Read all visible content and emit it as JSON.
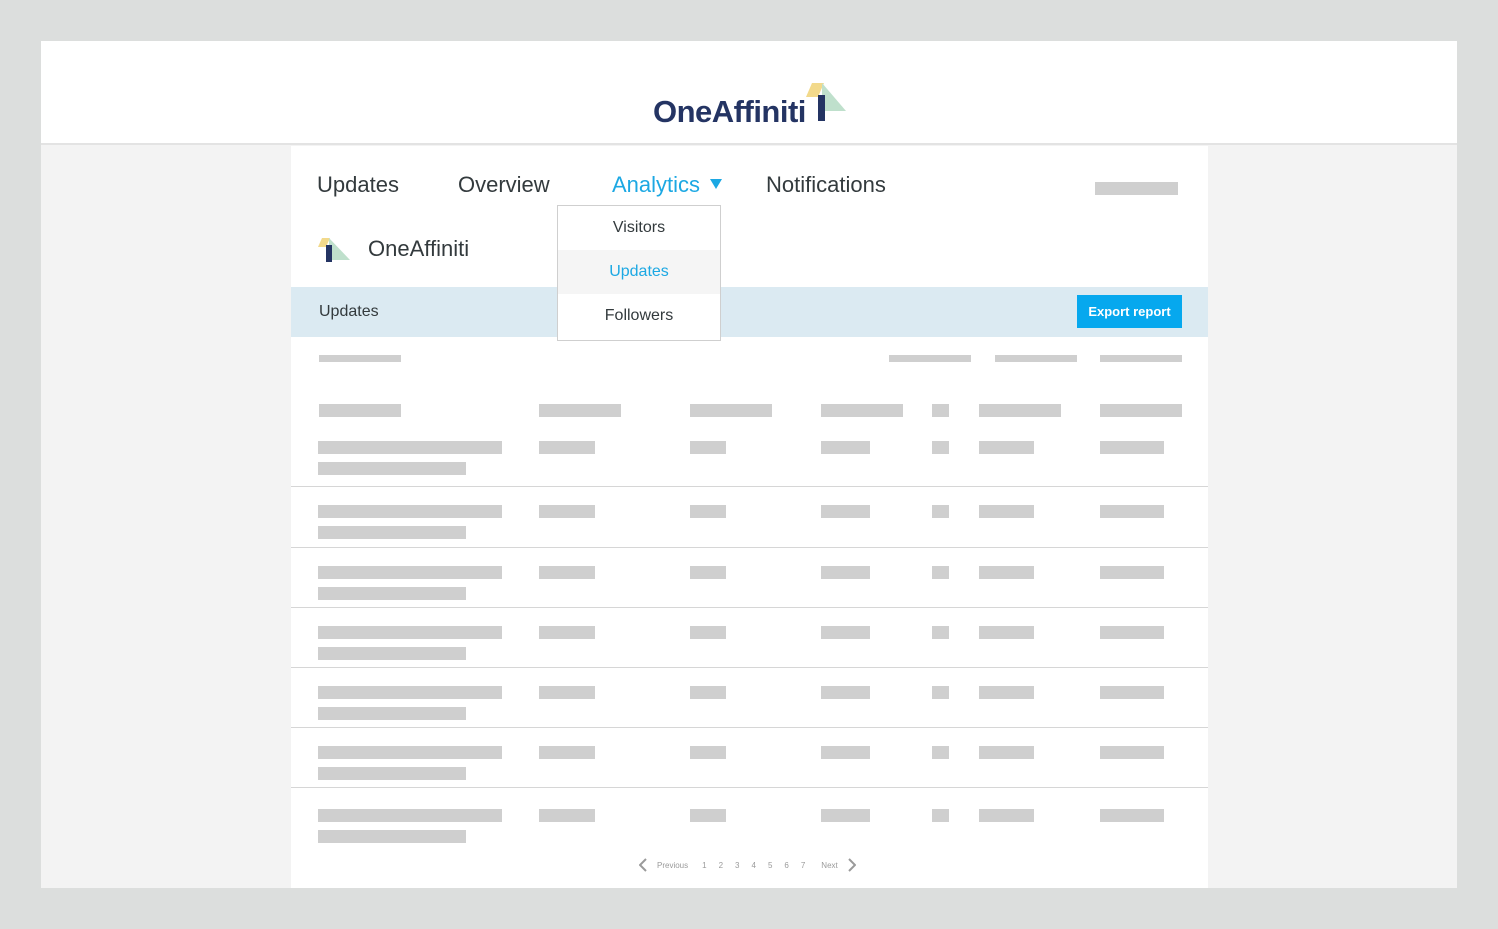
{
  "brand": {
    "name": "OneAffiniti"
  },
  "nav": {
    "items": [
      {
        "label": "Updates",
        "active": false
      },
      {
        "label": "Overview",
        "active": false
      },
      {
        "label": "Analytics",
        "active": true
      },
      {
        "label": "Notifications",
        "active": false
      }
    ]
  },
  "dropdown": {
    "items": [
      {
        "label": "Visitors",
        "selected": false
      },
      {
        "label": "Updates",
        "selected": true
      },
      {
        "label": "Followers",
        "selected": false
      }
    ]
  },
  "company": {
    "name": "OneAffiniti"
  },
  "subheader": {
    "title": "Updates",
    "export_label": "Export report"
  },
  "table": {
    "row_count": 7
  },
  "pagination": {
    "previous_label": "Previous",
    "pages": [
      "1",
      "2",
      "3",
      "4",
      "5",
      "6",
      "7"
    ],
    "next_label": "Next"
  },
  "colors": {
    "accent": "#1ca8e3",
    "button": "#06a8ee",
    "brand_navy": "#243463",
    "subheader_bg": "#dbeaf2",
    "placeholder": "#cfcfcf"
  }
}
